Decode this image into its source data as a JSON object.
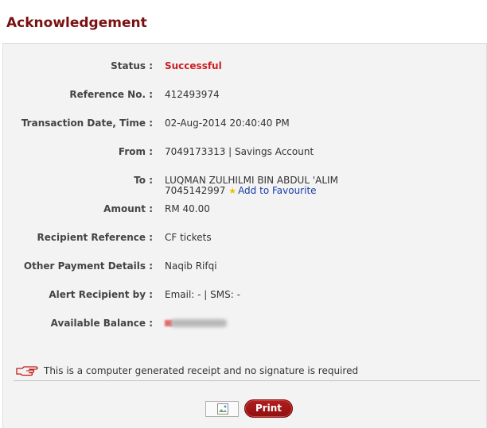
{
  "page_title": "Acknowledgement",
  "details": {
    "status": {
      "label": "Status :",
      "value": "Successful"
    },
    "reference": {
      "label": "Reference No. :",
      "value": "412493974"
    },
    "transaction_date": {
      "label": "Transaction Date, Time :",
      "value": "02-Aug-2014 20:40:40 PM"
    },
    "from": {
      "label": "From :",
      "value": "7049173313 | Savings Account"
    },
    "to": {
      "label": "To :",
      "name": "LUQMAN ZULHILMI BIN ABDUL 'ALIM",
      "account": "7045142997",
      "favourite_link": "Add to Favourite"
    },
    "amount": {
      "label": "Amount :",
      "value": "RM 40.00"
    },
    "recipient_reference": {
      "label": "Recipient Reference :",
      "value": "CF tickets"
    },
    "other_payment": {
      "label": "Other Payment Details :",
      "value": "Naqib Rifqi"
    },
    "alert_recipient": {
      "label": "Alert Recipient by :",
      "value": "Email: - | SMS: -"
    },
    "available_balance": {
      "label": "Available Balance :",
      "value": "[redacted]"
    }
  },
  "footer": {
    "note": "This is a computer generated receipt and no signature is required",
    "print_label": "Print"
  },
  "colors": {
    "title": "#7a1010",
    "status": "#cc1f24",
    "link": "#1a3ea8",
    "button": "#9e1515"
  },
  "icons": {
    "note_icon": "pointing-hand-icon",
    "favourite_icon": "star-icon",
    "image_icon": "broken-image-icon"
  }
}
